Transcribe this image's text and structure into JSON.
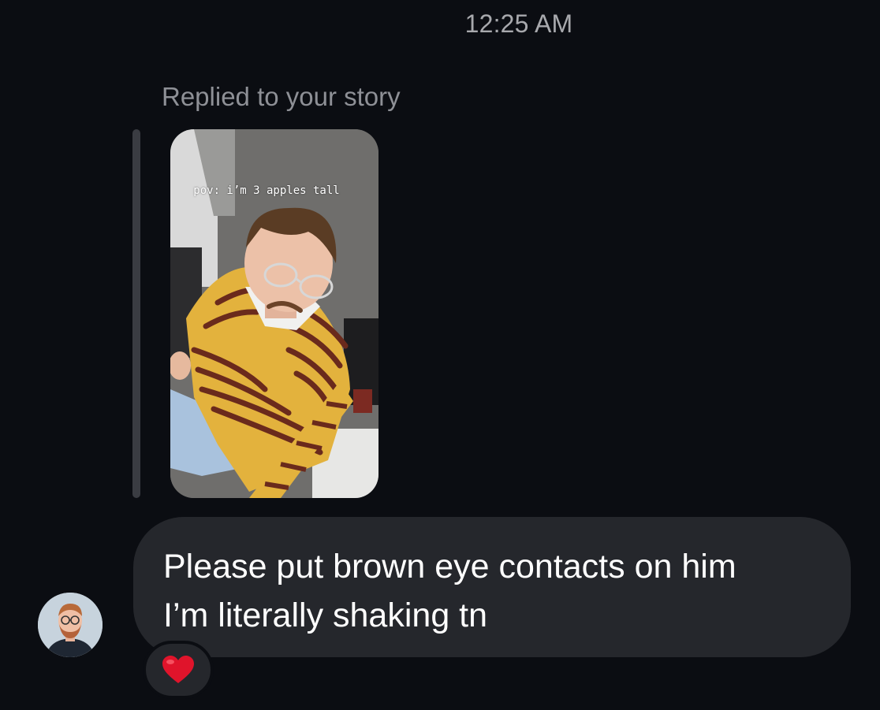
{
  "thread": {
    "timestamp": "12:25 AM"
  },
  "story_reply": {
    "label": "Replied to your story",
    "story_caption": "pov: i’m 3 apples tall"
  },
  "message": {
    "text": "Please put brown eye contacts on him\nI’m literally shaking tn",
    "reaction": "heart-emoji"
  },
  "sender": {
    "avatar_icon": "profile-photo"
  },
  "colors": {
    "background": "#0b0d12",
    "bubble": "#25272c",
    "secondary_text": "#8e9096",
    "heart": "#e0142b"
  }
}
